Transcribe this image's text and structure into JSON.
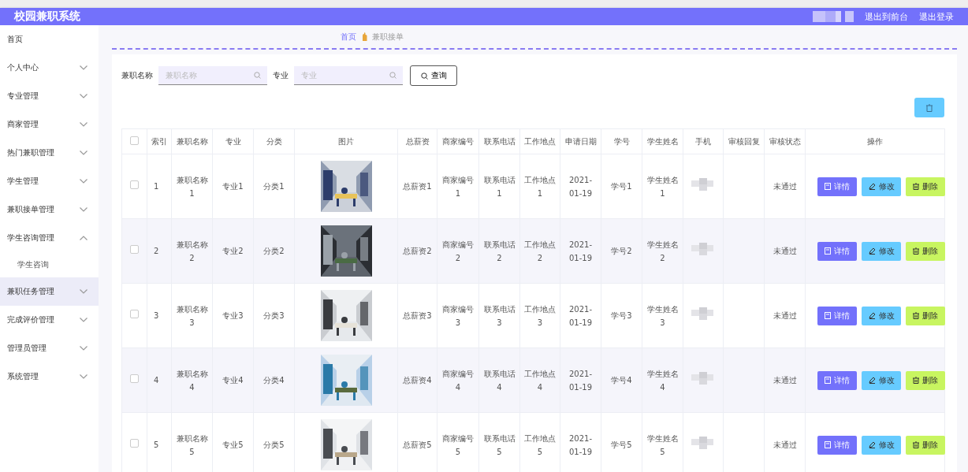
{
  "header": {
    "title": "校园兼职系统",
    "links": [
      "退出到前台",
      "退出登录"
    ]
  },
  "sidebar": {
    "items": [
      {
        "label": "首页",
        "hovered": false,
        "has_arrow": false
      },
      {
        "label": "个人中心",
        "expanded": false,
        "hovered": false,
        "has_arrow": true
      },
      {
        "label": "专业管理",
        "expanded": false,
        "hovered": false,
        "has_arrow": true
      },
      {
        "label": "商家管理",
        "expanded": false,
        "hovered": false,
        "has_arrow": true
      },
      {
        "label": "热门兼职管理",
        "expanded": false,
        "hovered": false,
        "has_arrow": true
      },
      {
        "label": "学生管理",
        "expanded": false,
        "hovered": false,
        "has_arrow": true
      },
      {
        "label": "兼职接单管理",
        "expanded": false,
        "hovered": false,
        "has_arrow": true
      },
      {
        "label": "学生咨询管理",
        "expanded": true,
        "hovered": false,
        "has_arrow": true,
        "children": [
          {
            "label": "学生咨询"
          }
        ]
      },
      {
        "label": "兼职任务管理",
        "expanded": false,
        "hovered": true,
        "has_arrow": true
      },
      {
        "label": "完成评价管理",
        "expanded": false,
        "hovered": false,
        "has_arrow": true
      },
      {
        "label": "管理员管理",
        "expanded": false,
        "hovered": false,
        "has_arrow": true
      },
      {
        "label": "系统管理",
        "expanded": false,
        "hovered": false,
        "has_arrow": true
      }
    ]
  },
  "breadcrumb": [
    "首页",
    "兼职接单"
  ],
  "search": [
    {
      "label": "兼职名称",
      "placeholder": "兼职名称"
    },
    {
      "label": "专业",
      "placeholder": "专业"
    }
  ],
  "query_button": "查询",
  "table": {
    "select_all_checked": false,
    "columns": [
      "索引",
      "兼职名称",
      "专业",
      "分类",
      "图片",
      "总薪资",
      "商家编号",
      "联系电话",
      "工作地点",
      "申请日期",
      "学号",
      "学生姓名",
      "手机",
      "审核回复",
      "审核状态",
      "操作"
    ],
    "rows": [
      {
        "checked": false,
        "cells": [
          "1",
          "兼职名称1",
          "专业1",
          "分类1",
          "",
          "总薪资1",
          "商家编号1",
          "联系电话1",
          "工作地点1",
          "2021-01-19",
          "学号1",
          "学生姓名1",
          "",
          "",
          "未通过"
        ],
        "actions": [
          {
            "kind": "detail",
            "label": "详情"
          },
          {
            "kind": "edit",
            "label": "修改"
          },
          {
            "kind": "delete",
            "label": "删除"
          }
        ]
      },
      {
        "checked": false,
        "cells": [
          "2",
          "兼职名称2",
          "专业2",
          "分类2",
          "",
          "总薪资2",
          "商家编号2",
          "联系电话2",
          "工作地点2",
          "2021-01-19",
          "学号2",
          "学生姓名2",
          "",
          "",
          "未通过"
        ],
        "actions": [
          {
            "kind": "detail",
            "label": "详情"
          },
          {
            "kind": "edit",
            "label": "修改"
          },
          {
            "kind": "delete",
            "label": "删除"
          }
        ]
      },
      {
        "checked": false,
        "cells": [
          "3",
          "兼职名称3",
          "专业3",
          "分类3",
          "",
          "总薪资3",
          "商家编号3",
          "联系电话3",
          "工作地点3",
          "2021-01-19",
          "学号3",
          "学生姓名3",
          "",
          "",
          "未通过"
        ],
        "actions": [
          {
            "kind": "detail",
            "label": "详情"
          },
          {
            "kind": "edit",
            "label": "修改"
          },
          {
            "kind": "delete",
            "label": "删除"
          }
        ]
      },
      {
        "checked": false,
        "cells": [
          "4",
          "兼职名称4",
          "专业4",
          "分类4",
          "",
          "总薪资4",
          "商家编号4",
          "联系电话4",
          "工作地点4",
          "2021-01-19",
          "学号4",
          "学生姓名4",
          "",
          "",
          "未通过"
        ],
        "actions": [
          {
            "kind": "detail",
            "label": "详情"
          },
          {
            "kind": "edit",
            "label": "修改"
          },
          {
            "kind": "delete",
            "label": "删除"
          }
        ]
      },
      {
        "checked": false,
        "cells": [
          "5",
          "兼职名称5",
          "专业5",
          "分类5",
          "",
          "总薪资5",
          "商家编号5",
          "联系电话5",
          "工作地点5",
          "2021-01-19",
          "学号5",
          "学生姓名5",
          "",
          "",
          "未通过"
        ],
        "actions": [
          {
            "kind": "detail",
            "label": "详情"
          },
          {
            "kind": "edit",
            "label": "修改"
          },
          {
            "kind": "delete",
            "label": "删除"
          }
        ]
      }
    ]
  }
}
